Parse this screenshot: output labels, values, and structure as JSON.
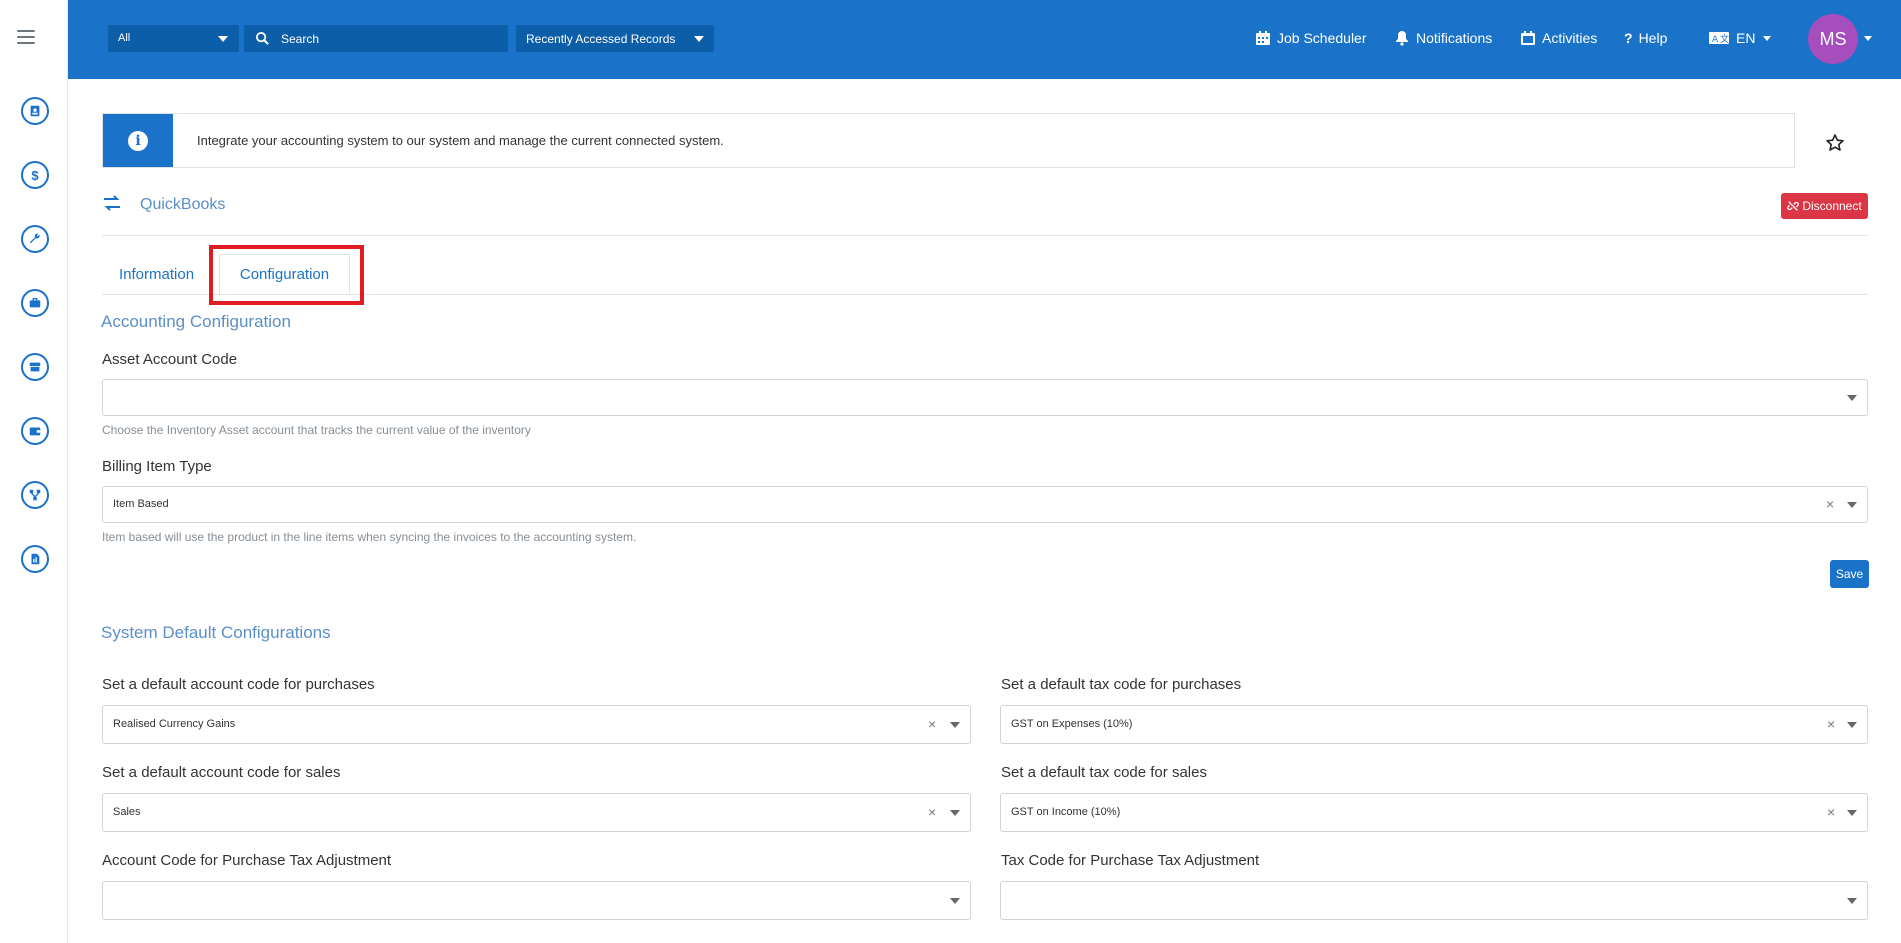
{
  "topbar": {
    "scope_select": "All",
    "search_placeholder": "Search",
    "recent_records": "Recently Accessed Records",
    "job_scheduler": "Job Scheduler",
    "notifications": "Notifications",
    "activities": "Activities",
    "help": "Help",
    "language": "EN",
    "avatar_initials": "MS"
  },
  "banner": {
    "text": "Integrate your accounting system to our system and manage the current connected system."
  },
  "integration": {
    "name": "QuickBooks",
    "disconnect_label": "Disconnect"
  },
  "tabs": [
    {
      "label": "Information"
    },
    {
      "label": "Configuration"
    }
  ],
  "accounting": {
    "title": "Accounting Configuration",
    "asset_label": "Asset Account Code",
    "asset_value": "",
    "asset_help": "Choose the Inventory Asset account that tracks the current value of the inventory",
    "billing_label": "Billing Item Type",
    "billing_value": "Item Based",
    "billing_help": "Item based will use the product in the line items when syncing the invoices to the accounting system.",
    "save_label": "Save"
  },
  "system_defaults": {
    "title": "System Default Configurations",
    "purchase_account_label": "Set a default account code for purchases",
    "purchase_account_value": "Realised Currency Gains",
    "purchase_tax_label": "Set a default tax code for purchases",
    "purchase_tax_value": "GST on Expenses (10%)",
    "sales_account_label": "Set a default account code for sales",
    "sales_account_value": "Sales",
    "sales_tax_label": "Set a default tax code for sales",
    "sales_tax_value": "GST on Income (10%)",
    "purchase_adj_account_label": "Account Code for Purchase Tax Adjustment",
    "purchase_adj_account_value": "",
    "purchase_adj_tax_label": "Tax Code for Purchase Tax Adjustment",
    "purchase_adj_tax_value": ""
  },
  "colors": {
    "brand_blue": "#1a73c9",
    "danger": "#dc3545",
    "highlight": "#e11b22",
    "avatar": "#a64ebd"
  }
}
